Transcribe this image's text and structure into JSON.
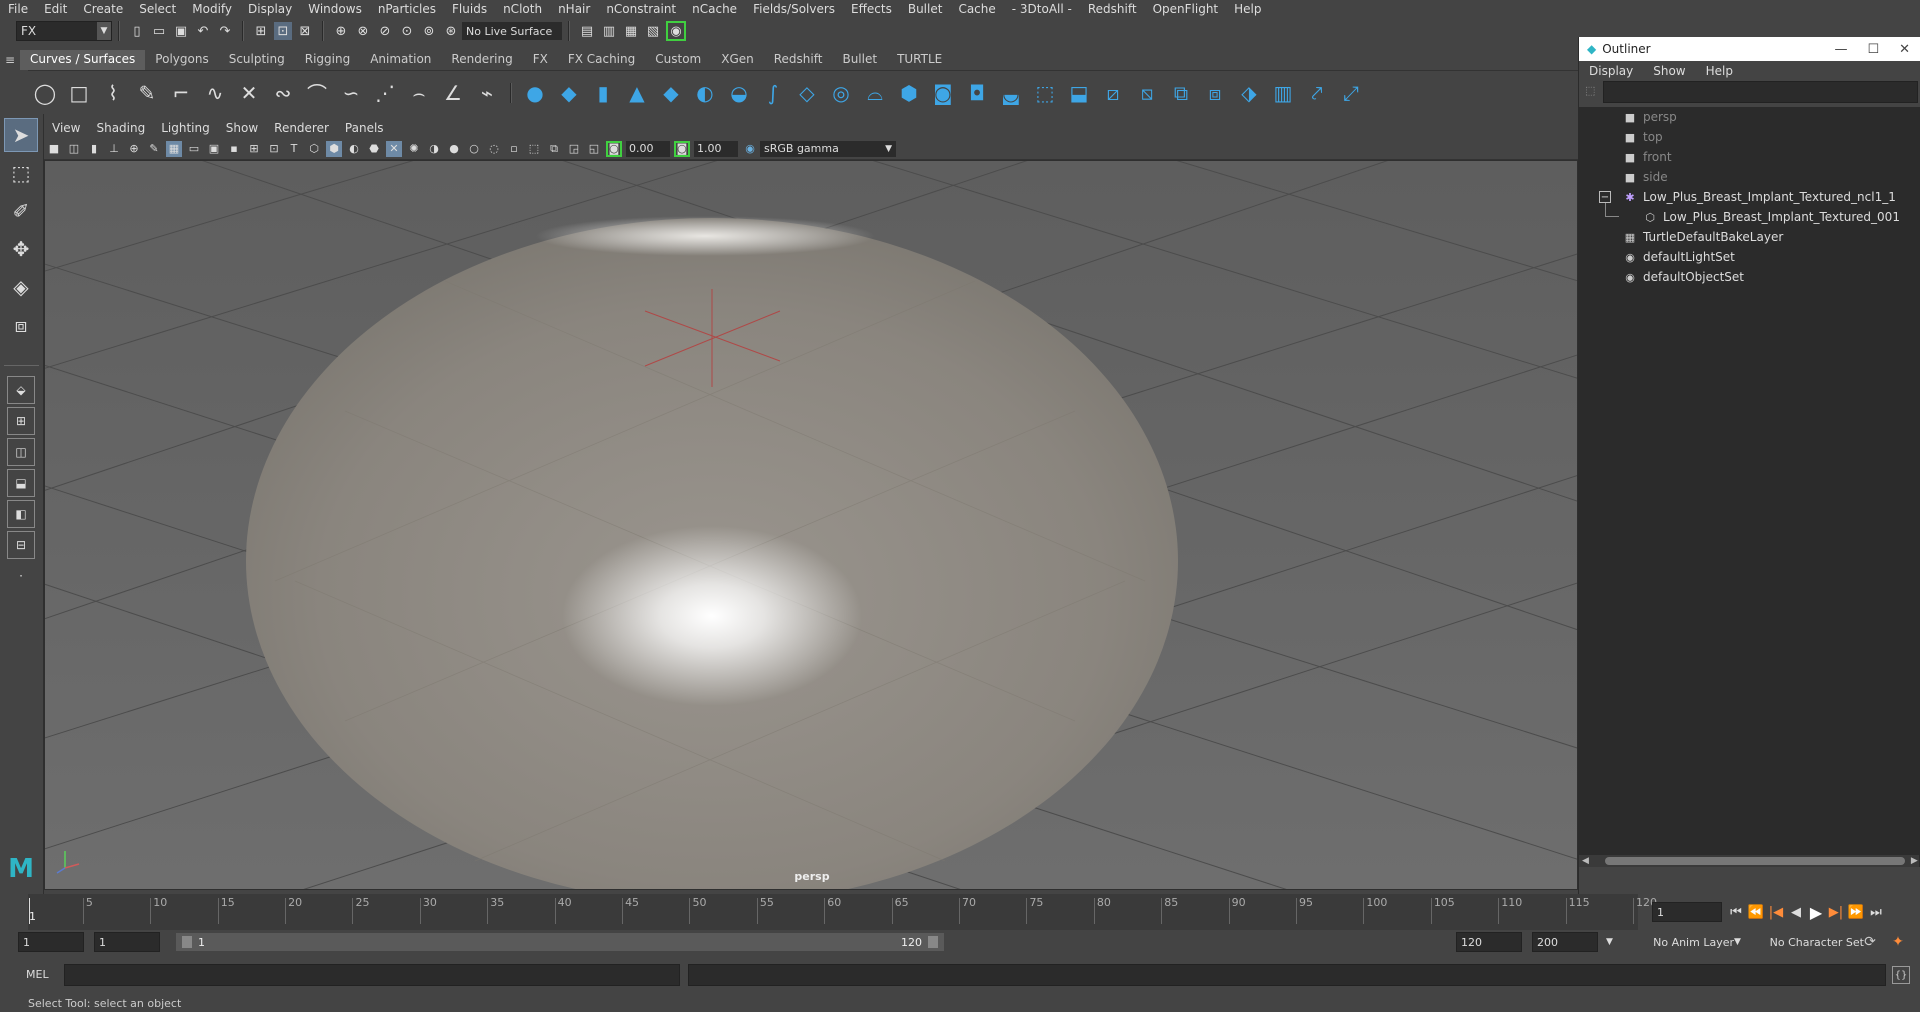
{
  "menubar": [
    "File",
    "Edit",
    "Create",
    "Select",
    "Modify",
    "Display",
    "Windows",
    "nParticles",
    "Fluids",
    "nCloth",
    "nHair",
    "nConstraint",
    "nCache",
    "Fields/Solvers",
    "Effects",
    "Bullet",
    "Cache",
    "- 3DtoAll -",
    "Redshift",
    "OpenFlight",
    "Help"
  ],
  "statusline": {
    "mode": "FX",
    "live_surface": "No Live Surface"
  },
  "shelf_tabs": [
    "Curves / Surfaces",
    "Polygons",
    "Sculpting",
    "Rigging",
    "Animation",
    "Rendering",
    "FX",
    "FX Caching",
    "Custom",
    "XGen",
    "Redshift",
    "Bullet",
    "TURTLE"
  ],
  "shelf_icons": [
    "circle-icon",
    "square-icon",
    "cv-curve-icon",
    "ep-curve-icon",
    "pencil-curve-icon",
    "arc-icon",
    "curve-icon",
    "cut-curve-icon",
    "rebuild-curve-icon",
    "attach-curve-icon",
    "bezier-curve-icon",
    "curve-extend-icon",
    "offset-curve-icon",
    "curve-fillet-icon",
    "curve-icon-2"
  ],
  "shelf_blue_icons": [
    "sphere-icon",
    "cube-icon",
    "cylinder-icon",
    "cone-icon",
    "plane-icon",
    "torus-icon",
    "revolve-icon",
    "loft-icon",
    "planar-icon",
    "extrude-icon",
    "birail-icon",
    "boundary-icon",
    "square-surface-icon",
    "bevel-icon",
    "intersect-icon",
    "project-curve-icon",
    "trim-icon",
    "untrim-icon",
    "attach-surface-icon",
    "detach-surface-icon",
    "align-icon",
    "open-close-icon",
    "rebuild-surface-icon",
    "sculpt-icon",
    "paint-icon"
  ],
  "panel_menu": [
    "View",
    "Shading",
    "Lighting",
    "Show",
    "Renderer",
    "Panels"
  ],
  "panel_toolbar": {
    "exposure": "0.00",
    "gamma": "1.00",
    "colorspace": "sRGB gamma"
  },
  "viewport": {
    "camera_label": "persp"
  },
  "outliner": {
    "title": "Outliner",
    "menu": [
      "Display",
      "Show",
      "Help"
    ],
    "items": [
      {
        "label": "persp",
        "icon": "camera-icon",
        "dim": true
      },
      {
        "label": "top",
        "icon": "camera-icon",
        "dim": true
      },
      {
        "label": "front",
        "icon": "camera-icon",
        "dim": true
      },
      {
        "label": "side",
        "icon": "camera-icon",
        "dim": true
      },
      {
        "label": "Low_Plus_Breast_Implant_Textured_ncl1_1",
        "icon": "group-icon",
        "dim": false
      },
      {
        "label": "Low_Plus_Breast_Implant_Textured_001",
        "icon": "mesh-icon",
        "dim": false
      },
      {
        "label": "TurtleDefaultBakeLayer",
        "icon": "bake-layer-icon",
        "dim": false
      },
      {
        "label": "defaultLightSet",
        "icon": "set-icon",
        "dim": false
      },
      {
        "label": "defaultObjectSet",
        "icon": "set-icon",
        "dim": false
      }
    ]
  },
  "timeline": {
    "ticks": [
      "1",
      "5",
      "10",
      "15",
      "20",
      "25",
      "30",
      "35",
      "40",
      "45",
      "50",
      "55",
      "60",
      "65",
      "70",
      "75",
      "80",
      "85",
      "90",
      "95",
      "100",
      "105",
      "110",
      "115",
      "120"
    ],
    "current_frame": "1"
  },
  "range": {
    "start_input": "1",
    "start_input2": "1",
    "range_start": "1",
    "range_end": "120",
    "end_input": "120",
    "end_input2": "200",
    "anim_layer": "No Anim Layer",
    "character_set": "No Character Set"
  },
  "cmdline": {
    "label": "MEL"
  },
  "helpline": "Select Tool: select an object",
  "colors": {
    "accent": "#3ea6e6",
    "key": "#ff8c3a",
    "active_tool": "#5a6c80"
  }
}
